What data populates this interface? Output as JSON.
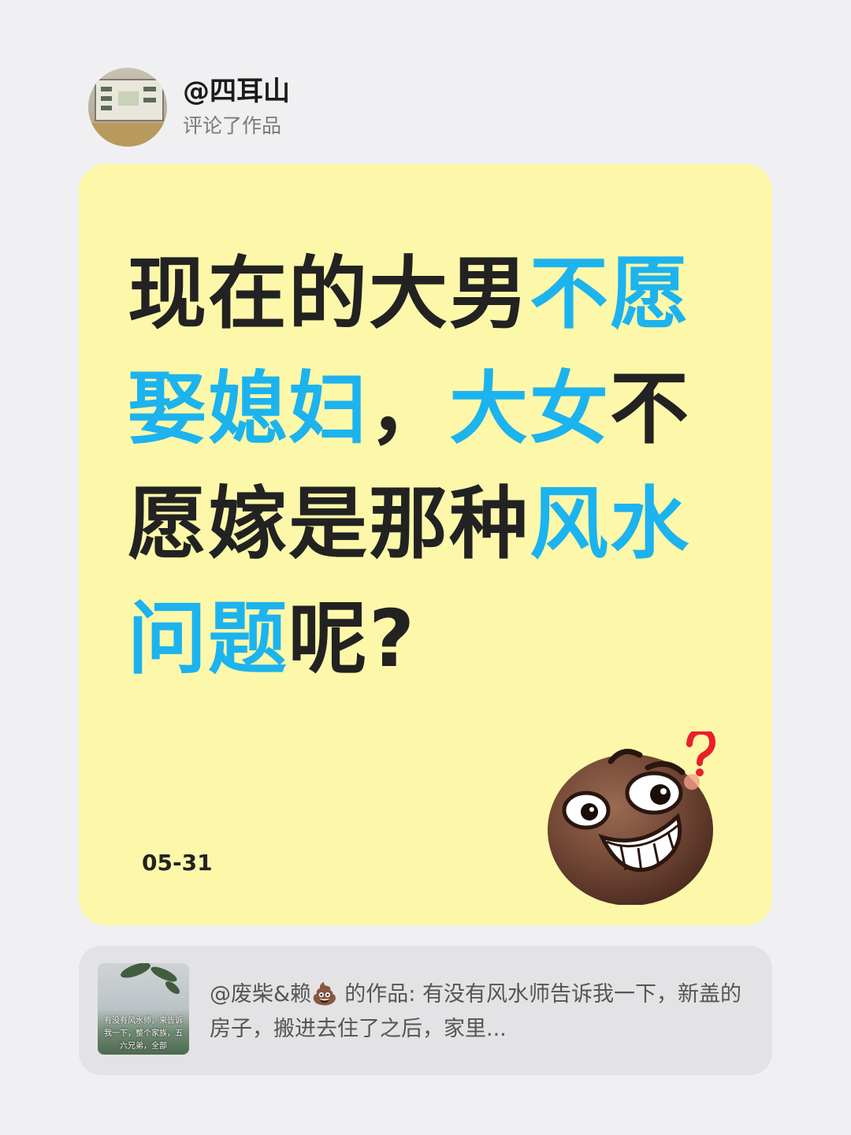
{
  "header": {
    "username": "@四耳山",
    "action": "评论了作品"
  },
  "comment": {
    "segments": [
      {
        "text": "现在的大男",
        "highlight": false
      },
      {
        "text": "不愿娶媳妇",
        "highlight": true
      },
      {
        "text": "，",
        "highlight": false
      },
      {
        "text": "大女",
        "highlight": true
      },
      {
        "text": "不愿嫁是那种",
        "highlight": false
      },
      {
        "text": "风水问题",
        "highlight": true
      },
      {
        "text": "呢?",
        "highlight": false
      }
    ],
    "date": "05-31",
    "emoji": "confused-grin-emoji"
  },
  "reference": {
    "thumbnail_text": "有没有风水师，来告诉我一下，整个家族，五六兄弟，全部",
    "author": "@废柴&赖",
    "author_emoji": "💩",
    "text": " 的作品: 有没有风水师告诉我一下，新盖的房子，搬进去住了之后，家里..."
  },
  "colors": {
    "card_bg": "#fdf8a9",
    "highlight": "#1cb3ef",
    "page_bg": "#f0f0f2"
  }
}
